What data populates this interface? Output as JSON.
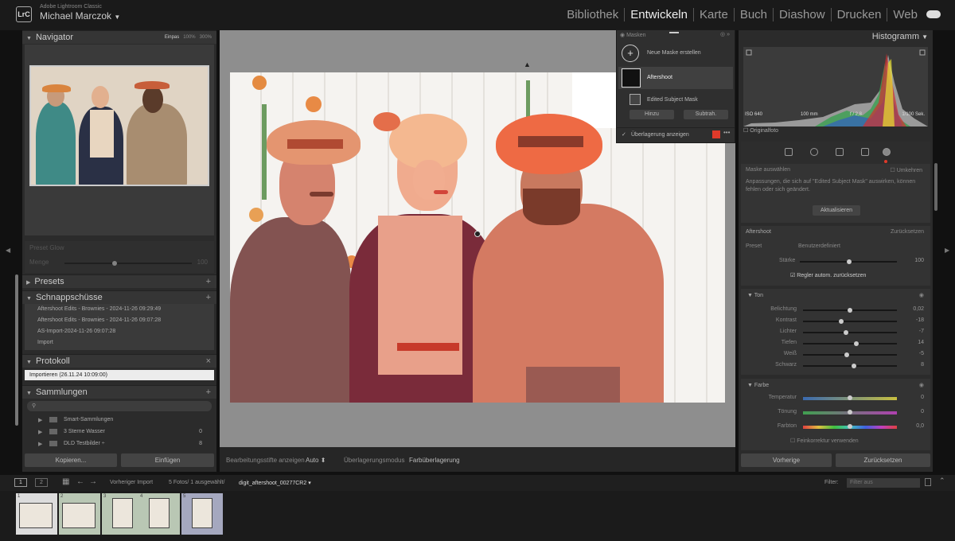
{
  "app": {
    "name": "Adobe Lightroom Classic",
    "logo": "LrC",
    "user": "Michael Marczok",
    "modules": [
      "Bibliothek",
      "Entwickeln",
      "Karte",
      "Buch",
      "Diashow",
      "Drucken",
      "Web"
    ],
    "active_module": "Entwickeln"
  },
  "left_panel": {
    "navigator": {
      "title": "Navigator",
      "zoom_options": [
        "Einpas",
        "100%",
        "300%"
      ]
    },
    "effects": {
      "label": "Preset Glow",
      "sublabel": "Menge",
      "value": "100"
    },
    "presets": {
      "title": "Presets"
    },
    "snapshots": {
      "title": "Schnappschüsse",
      "items": [
        "Aftershoot Edits - Brownies - 2024-11-26 09:29:49",
        "Aftershoot Edits - Brownies - 2024-11-26 09:07:28",
        "AS-Import-2024-11-26 09:07:28",
        "Import"
      ]
    },
    "history": {
      "title": "Protokoll",
      "items": [
        "Importieren (26.11.24 10:09:00)"
      ]
    },
    "collections": {
      "title": "Sammlungen",
      "items": [
        {
          "name": "Smart-Sammlungen",
          "count": ""
        },
        {
          "name": "3 Sterne Wasser",
          "count": "0"
        },
        {
          "name": "DLD Testbilder ÷",
          "count": "8"
        }
      ]
    },
    "copy_button": "Kopieren...",
    "paste_button": "Einfügen"
  },
  "mask_panel": {
    "title": "Masken",
    "new_mask": "Neue Maske erstellen",
    "mask_name": "Aftershoot",
    "sub_mask": "Edited Subject Mask",
    "add_button": "Hinzu",
    "subtract_button": "Subtrah.",
    "overlay_label": "Überlagerung anzeigen",
    "overlay_checked": true,
    "overlay_color": "#e03a2a"
  },
  "bottom_toolbar": {
    "edit_pins_label": "Bearbeitungsstifte anzeigen",
    "edit_pins_value": "Auto",
    "overlay_mode_label": "Überlagerungsmodus",
    "overlay_mode_value": "Farbüberlagerung"
  },
  "right_panel": {
    "histogram": {
      "title": "Histogramm",
      "iso": "ISO 640",
      "shutter": "100 mm",
      "aperture": "f / 2,8",
      "exposure": "1/100 Sek.",
      "original_label": "Originalfoto"
    },
    "mask_options": {
      "select_label": "Maske auswählen",
      "invert_label": "Umkehren",
      "description": "Anpassungen, die sich auf \"Edited Subject Mask\" auswirken, können fehlen oder sich geändert.",
      "update_button": "Aktualisieren"
    },
    "preset_section": {
      "name": "Aftershoot",
      "reset_label": "Zurücksetzen",
      "preset_label": "Preset",
      "preset_value": "Benutzerdefiniert",
      "amount_label": "Stärke",
      "amount_value": "100",
      "auto_reset_label": "Regler autom. zurücksetzen"
    },
    "tone": {
      "title": "Ton",
      "sliders": [
        {
          "label": "Belichtung",
          "value": "0,02",
          "pos": 0.5
        },
        {
          "label": "Kontrast",
          "value": "-18",
          "pos": 0.41
        },
        {
          "label": "Lichter",
          "value": "-7",
          "pos": 0.46
        },
        {
          "label": "Tiefen",
          "value": "14",
          "pos": 0.57
        },
        {
          "label": "Weiß",
          "value": "-5",
          "pos": 0.47
        },
        {
          "label": "Schwarz",
          "value": "8",
          "pos": 0.54
        }
      ]
    },
    "color": {
      "title": "Farbe",
      "sliders": [
        {
          "label": "Temperatur",
          "value": "0",
          "pos": 0.5
        },
        {
          "label": "Tönung",
          "value": "0",
          "pos": 0.5
        },
        {
          "label": "Farbton",
          "value": "0,0",
          "pos": 0.5
        }
      ],
      "fine_adjust_label": "Feinkorrektur verwenden"
    },
    "previous_button": "Vorherige",
    "reset_button": "Zurücksetzen"
  },
  "filmbar": {
    "pages": [
      "1",
      "2"
    ],
    "source": "Vorheriger Import",
    "count": "5 Fotos/ 1 ausgewählt/",
    "filename": "digit_aftershoot_00277CR2",
    "filter_label": "Filter:",
    "filter_value": "Filter aus"
  },
  "filmstrip": {
    "items": [
      "1",
      "2",
      "3",
      "4",
      "5"
    ]
  }
}
